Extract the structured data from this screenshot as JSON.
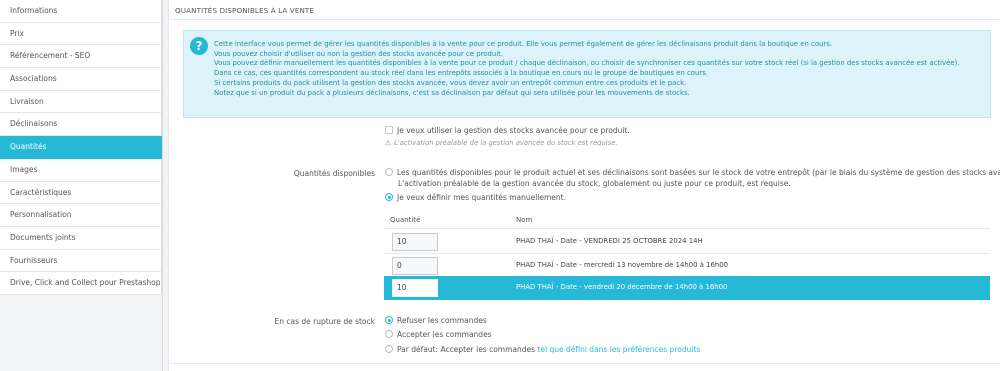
{
  "sidebar": {
    "items": [
      {
        "label": "Informations"
      },
      {
        "label": "Prix"
      },
      {
        "label": "Référencement - SEO"
      },
      {
        "label": "Associations"
      },
      {
        "label": "Livraison"
      },
      {
        "label": "Déclinaisons"
      },
      {
        "label": "Quantités",
        "active": true
      },
      {
        "label": "Images"
      },
      {
        "label": "Caractéristiques"
      },
      {
        "label": "Personnalisation"
      },
      {
        "label": "Documents joints"
      },
      {
        "label": "Fournisseurs"
      },
      {
        "label": "Drive, Click and Collect pour Prestashop"
      }
    ]
  },
  "panel": {
    "title": "QUANTITÉS DISPONIBLES À LA VENTE"
  },
  "info": {
    "lines": [
      "Cette interface vous permet de gérer les quantités disponibles à la vente pour ce produit. Elle vous permet également de gérer les déclinaisons produit dans la boutique en cours.",
      "Vous pouvez choisir d'utiliser ou non la gestion des stocks avancée pour ce produit.",
      "Vous pouvez définir manuellement les quantités disponibles à la vente pour ce produit / chaque déclinaison, ou choisir de synchroniser ces quantités sur votre stock réel (si la gestion des stocks avancée est activée).",
      "Dans ce cas, ces quantités correspondent au stock réel dans les entrepôts associés à la boutique en cours ou le groupe de boutiques en cours.",
      "Si certains produits du pack utilisent la gestion des stocks avancée, vous devez avoir un entrepôt commun entre ces produits et le pack.",
      "Notez que si un produit du pack a plusieurs déclinaisons, c'est sa déclinaison par défaut qui sera utilisée pour les mouvements de stocks."
    ]
  },
  "advanced_stock": {
    "checkbox_label": "Je veux utiliser la gestion des stocks avancée pour ce produit.",
    "note": "L'activation préalable de la gestion avancée du stock est requise."
  },
  "quantities": {
    "label": "Quantités disponibles",
    "option_auto_line1": "Les quantités disponibles pour le produit actuel et ses déclinaisons sont basées sur le stock de votre entrepôt (par le biais du système de gestion des stocks avancée). -",
    "option_auto_line2": "L'activation préalable de la gestion avancée du stock, globalement ou juste pour ce produit, est requise.",
    "option_manual": "Je veux définir mes quantités manuellement.",
    "table": {
      "col_quantity": "Quantité",
      "col_name": "Nom",
      "rows": [
        {
          "qty": "10",
          "name": "PHAD THAÏ - Date - VENDREDI 25 OCTOBRE 2024 14H"
        },
        {
          "qty": "0",
          "name": "PHAD THAÏ - Date - mercredi 13 novembre de 14h00 à 16h00"
        },
        {
          "qty": "10",
          "name": "PHAD THAÏ - Date - vendredi 20 décembre de 14h00 à 16h00",
          "selected": true
        }
      ]
    }
  },
  "out_of_stock": {
    "label": "En cas de rupture de stock",
    "options": {
      "refuse": "Refuser les commandes",
      "accept": "Accepter les commandes",
      "default_prefix": "Par défaut: Accepter les commandes",
      "default_link": "tel que défini dans les préférences produits"
    }
  }
}
